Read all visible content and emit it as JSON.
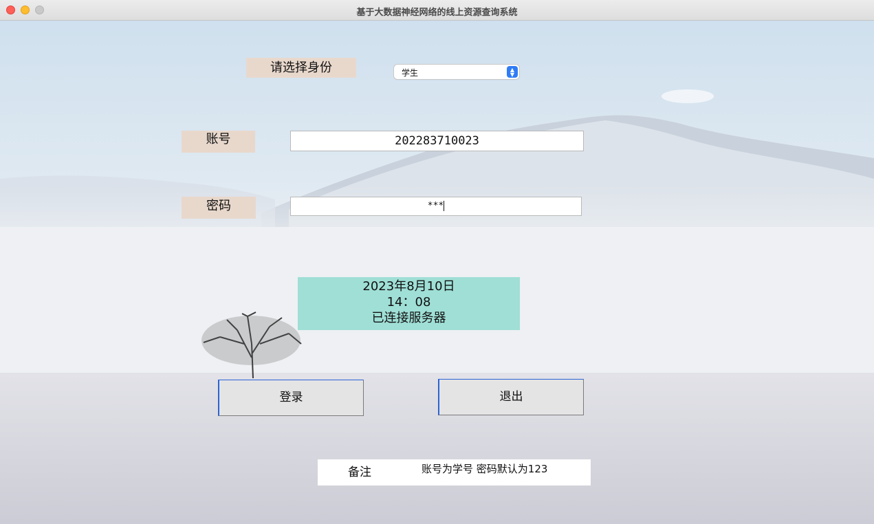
{
  "window": {
    "title": "基于大数据神经网络的线上资源查询系统"
  },
  "role": {
    "label": "请选择身份",
    "selected": "学生"
  },
  "account": {
    "label": "账号",
    "value": "202283710023"
  },
  "password": {
    "label": "密码",
    "value": "***"
  },
  "status": {
    "date": "2023年8月10日",
    "time": "14：08",
    "connection": "已连接服务器"
  },
  "buttons": {
    "login": "登录",
    "exit": "退出"
  },
  "note": {
    "label": "备注",
    "text": "账号为学号 密码默认为123"
  },
  "colors": {
    "label_bg": "#e8d8cc",
    "status_bg": "#9fdfd6",
    "button_focus": "#2b63d6"
  }
}
